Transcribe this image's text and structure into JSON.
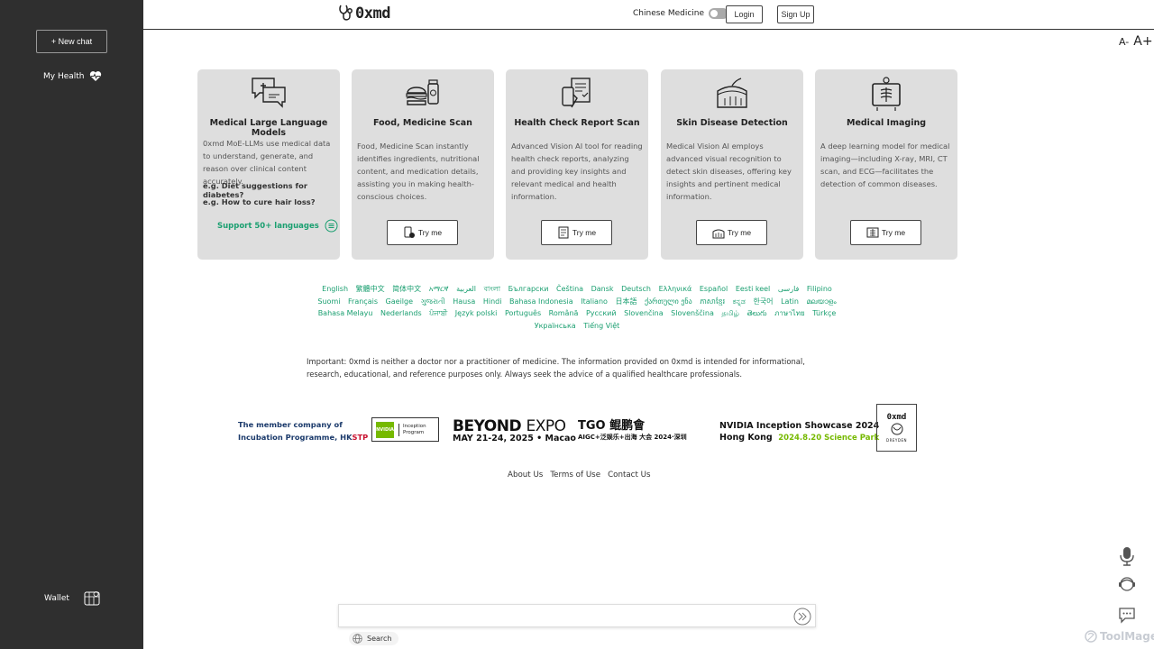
{
  "sidebar": {
    "new_chat": "+ New chat",
    "my_health": "My Health",
    "wallet": "Wallet"
  },
  "header": {
    "logo": "0xmd",
    "chinese_medicine": "Chinese Medicine",
    "login": "Login",
    "signup": "Sign Up",
    "font_smaller": "A-",
    "font_larger": "A+"
  },
  "cards": [
    {
      "title": "Medical Large Language Models",
      "desc": "0xmd MoE-LLMs use medical data to understand, generate, and reason over clinical content accurately.",
      "example1": "e.g. Diet suggestions for diabetes?",
      "example2": "e.g. How to cure hair loss?",
      "support": "Support 50+ languages"
    },
    {
      "title": "Food, Medicine Scan",
      "desc": "Food, Medicine Scan instantly identifies ingredients, nutritional content, and medication details, assisting you in making health-conscious choices.",
      "button": "Try me"
    },
    {
      "title": "Health Check Report Scan",
      "desc": "Advanced Vision AI tool for reading health check reports, analyzing and providing key insights and relevant medical and health information.",
      "button": "Try me"
    },
    {
      "title": "Skin Disease Detection",
      "desc": "Medical Vision AI employs advanced visual recognition to detect skin diseases, offering key insights and pertinent medical information.",
      "button": "Try me"
    },
    {
      "title": "Medical Imaging",
      "desc": "A deep learning model for medical imaging—including X-ray, MRI, CT scan, and ECG—facilitates the detection of common diseases.",
      "button": "Try me"
    }
  ],
  "languages": [
    "English",
    "繁體中文",
    "简体中文",
    "አማርኛ",
    "العربية",
    "বাংলা",
    "Български",
    "Čeština",
    "Dansk",
    "Deutsch",
    "Ελληνικά",
    "Español",
    "Eesti keel",
    "فارسی",
    "Filipino",
    "Suomi",
    "Français",
    "Gaeilge",
    "ગુજરાતી",
    "Hausa",
    "Hindi",
    "Bahasa Indonesia",
    "Italiano",
    "日本語",
    "ქართული ენა",
    "ភាសាខ្មែរ",
    "ಕನ್ನಡ",
    "한국어",
    "Latin",
    "മലയാളം",
    "Bahasa Melayu",
    "Nederlands",
    "ਪੰਜਾਬੀ",
    "Język polski",
    "Português",
    "Română",
    "Русский",
    "Slovenčina",
    "Slovenščina",
    "தமிழ்",
    "తెలుగు",
    "ภาษาไทย",
    "Türkçe",
    "Українська",
    "Tiếng Việt"
  ],
  "disclaimer": "Important: 0xmd is neither a doctor nor a practitioner of medicine. The information provided on 0xmd is intended for informational, research, educational, and reference purposes only. Always seek the advice of a qualified healthcare professionals.",
  "partners": {
    "hkstp_line1": "The member company of",
    "hkstp_line2": "Incubation Programme, HK",
    "hkstp_stp": "STP",
    "nvidia_logo": "NVIDIA",
    "nvidia_program": "Inception Program",
    "beyond_title_bold": "BEYOND",
    "beyond_title_light": "EXPO",
    "beyond_date": "MAY 21-24, 2025 • Macao",
    "tgo_title": "TGO 鲲鹏會",
    "tgo_sub": "AIGC+泛娱乐+出海 大会  2024·深圳",
    "showcase_line1": "NVIDIA Inception Showcase 2024",
    "showcase_line2": "Hong Kong",
    "showcase_date": "2024.8.20 Science Park",
    "dreyden_top": "0xmd",
    "dreyden_bottom": "DREYDEN"
  },
  "footer": {
    "about": "About Us",
    "terms": "Terms of Use",
    "contact": "Contact Us"
  },
  "chat": {
    "placeholder": "",
    "search": "Search"
  },
  "watermark": "ToolMage",
  "colors": {
    "sidebar_bg": "#2f2f2f",
    "card_bg": "#dedede",
    "accent_green": "#1a9f70"
  }
}
